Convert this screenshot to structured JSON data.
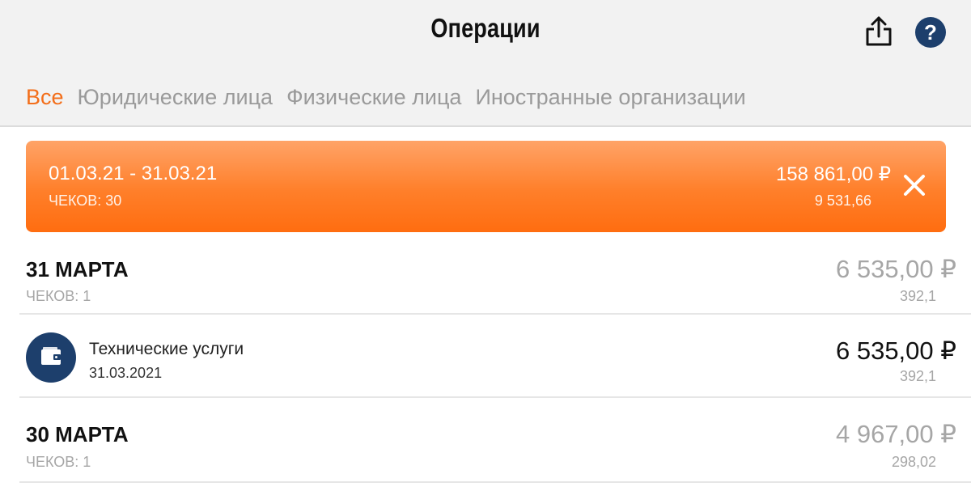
{
  "header": {
    "title": "Операции",
    "share_icon": "share-icon",
    "help_icon": "help-icon",
    "help_glyph": "?"
  },
  "tabs": [
    {
      "label": "Все",
      "active": true
    },
    {
      "label": "Юридические лица",
      "active": false
    },
    {
      "label": "Физические лица",
      "active": false
    },
    {
      "label": "Иностранные организации",
      "active": false
    }
  ],
  "period": {
    "dates": "01.03.21 - 31.03.21",
    "count": "ЧЕКОВ: 30",
    "sum": "158 861,00 ₽",
    "sub": "9 531,66",
    "close_icon": "close-icon"
  },
  "days": [
    {
      "title": "31 МАРТА",
      "count": "ЧЕКОВ: 1",
      "sum": "6 535,00 ₽",
      "sub": "392,1"
    },
    {
      "title": "30 МАРТА",
      "count": "ЧЕКОВ: 1",
      "sum": "4 967,00 ₽",
      "sub": "298,02"
    }
  ],
  "operations": [
    {
      "name": "Технические услуги",
      "date": "31.03.2021",
      "sum": "6 535,00 ₽",
      "sub": "392,1",
      "icon": "wallet-icon"
    }
  ],
  "colors": {
    "accent": "#f36e1a",
    "brand_navy": "#1d3f6c",
    "muted_text": "#a6a6a6",
    "banner_gradient_top": "#ffa367",
    "banner_gradient_bottom": "#ff6d10"
  }
}
